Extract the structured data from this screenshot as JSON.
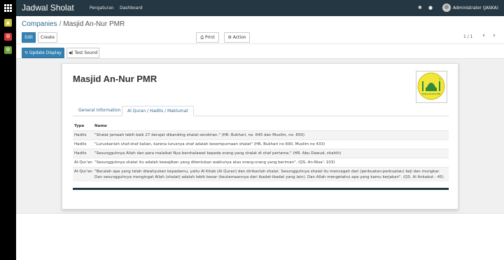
{
  "app": {
    "title": "Jadwal Sholat"
  },
  "topbar": {
    "menu": [
      "Pengaturan",
      "Dashboard"
    ],
    "bug_icon": "bug-icon",
    "chat_icon": "chat-icon",
    "user": "Administrator (JASKA)"
  },
  "breadcrumb": {
    "parent": "Companies",
    "separator": "/",
    "current": "Masjid An-Nur PMR"
  },
  "toolbar": {
    "edit": "Edit",
    "create": "Create",
    "print": "Print",
    "action": "Action",
    "pager": "1 / 1",
    "prev": "‹",
    "next": "›",
    "update_display": "Update Display",
    "test_sound": "Test Sound"
  },
  "record": {
    "name": "Masjid An-Nur PMR",
    "logo_text": "MASJID AN-NUR PMR",
    "tabs": [
      "General Information",
      "Al Quran / Hadits / Maklumat"
    ],
    "table": {
      "headers": {
        "type": "Type",
        "name": "Name"
      },
      "rows": [
        {
          "type": "Hadits",
          "name": "\"Shalat jamaah lebih baik 27 derajat dibanding shalat sendirian.\" (HR. Bukhari, no. 645 dan Muslim, no. 650)"
        },
        {
          "type": "Hadits",
          "name": "\"Luruskanlah shaf-shaf kalian, karena lurusnya shaf adalah kesempurnaan shalat\" (HR. Bukhari no 690, Muslim no 433)"
        },
        {
          "type": "Hadits",
          "name": "\"Sesungguhnya Allah dan para malaikat Nya bershalawat kepada orang yang shalat di shaf pertama.\" (HR. Abu Dawud, shahih)"
        },
        {
          "type": "Al-Qur'an",
          "name": "\"Sesungguhnya shalat itu adalah kewajiban yang ditentukan waktunya atas orang-orang yang beriman\". (QS. An-Nisa': 103)"
        },
        {
          "type": "Al-Qur'an",
          "name": "\"Bacalah apa yang telah diwahyukan kepadamu, yaitu Al Kitab (Al Quran) dan dirikanlah shalat. Sesungguhnya shalat itu mencegah dari (perbuatan-perbuatan) keji dan mungkar. Dan sesungguhnya mengingat Allah (shalat) adalah lebih besar (keutamaannya dari ibadat-ibadat yang lain). Dan Allah mengetahui apa yang kamu kerjakan\". (QS. Al Ankabut : 45)"
        }
      ]
    }
  },
  "colors": {
    "topbar": "#243742",
    "primary": "#3582b2",
    "link": "#2f6a8f"
  }
}
